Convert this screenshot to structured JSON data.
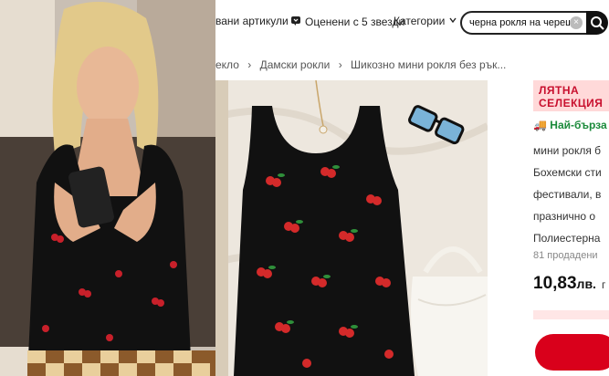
{
  "colors": {
    "accent_red": "#d9001b",
    "fast_green": "#1a8a3a",
    "badge_red": "#c8102e"
  },
  "topbar": {
    "tab_items": "вани артикули",
    "tab_rated": "Оценени с 5 звезди",
    "rated_icon": "thumbs-up-icon",
    "tab_categories": "Категории",
    "categories_icon": "chevron-down-icon"
  },
  "search": {
    "value": "черна рокля на череш",
    "clear_icon": "close-icon",
    "button_icon": "search-icon"
  },
  "breadcrumb": {
    "item1": "екло",
    "sep": "›",
    "item2": "Дамски рокли",
    "item3": "Шикозно мини рокля без рък..."
  },
  "info": {
    "badge_line1": "ЛЯТНА",
    "badge_line2": "СЕЛЕКЦИЯ",
    "fast_label": "Най-бърза",
    "desc_lines": [
      "мини рокля б",
      "Бохемски сти",
      "фестивали, в",
      "празнично о",
      "Полиестерна"
    ],
    "sold": "81 продадени",
    "price_main": "10,83",
    "price_unit": "лв.",
    "price_extra": "г"
  }
}
